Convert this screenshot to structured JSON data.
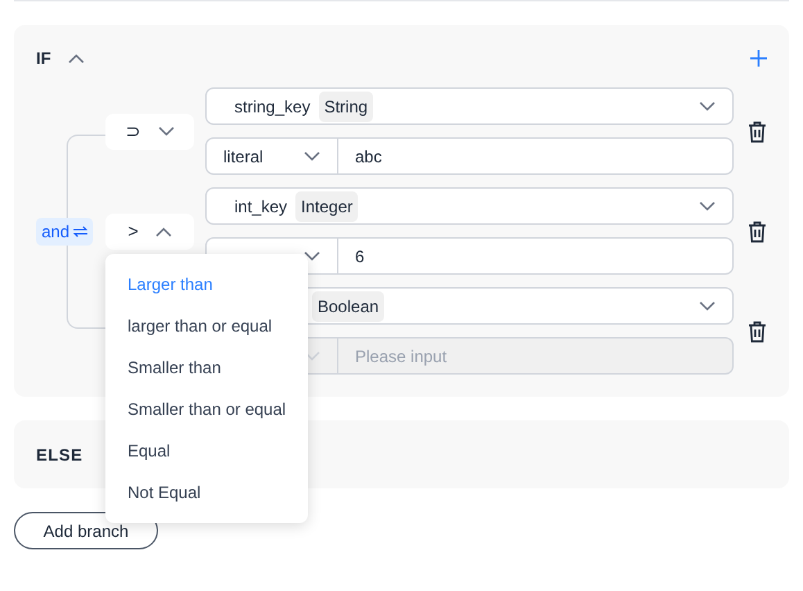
{
  "if_block": {
    "title": "IF",
    "expanded": true,
    "logic": {
      "label": "and"
    },
    "conditions": [
      {
        "operator": {
          "symbol": "⊃",
          "open": false
        },
        "variable": {
          "name": "string_key",
          "type": "String"
        },
        "value": {
          "source": "literal",
          "text": "abc",
          "disabled": false
        }
      },
      {
        "operator": {
          "symbol": ">",
          "open": true
        },
        "variable": {
          "name": "int_key",
          "type": "Integer"
        },
        "value": {
          "text": "6",
          "disabled": false
        }
      },
      {
        "variable": {
          "type": "Boolean"
        },
        "value": {
          "placeholder": "Please input",
          "disabled": true
        }
      }
    ]
  },
  "operator_menu": {
    "options": [
      {
        "label": "Larger than",
        "selected": true
      },
      {
        "label": "larger than or equal",
        "selected": false
      },
      {
        "label": "Smaller than",
        "selected": false
      },
      {
        "label": "Smaller than or equal",
        "selected": false
      },
      {
        "label": "Equal",
        "selected": false
      },
      {
        "label": "Not Equal",
        "selected": false
      }
    ]
  },
  "else_block": {
    "title": "ELSE"
  },
  "add_branch_button": "Add branch"
}
